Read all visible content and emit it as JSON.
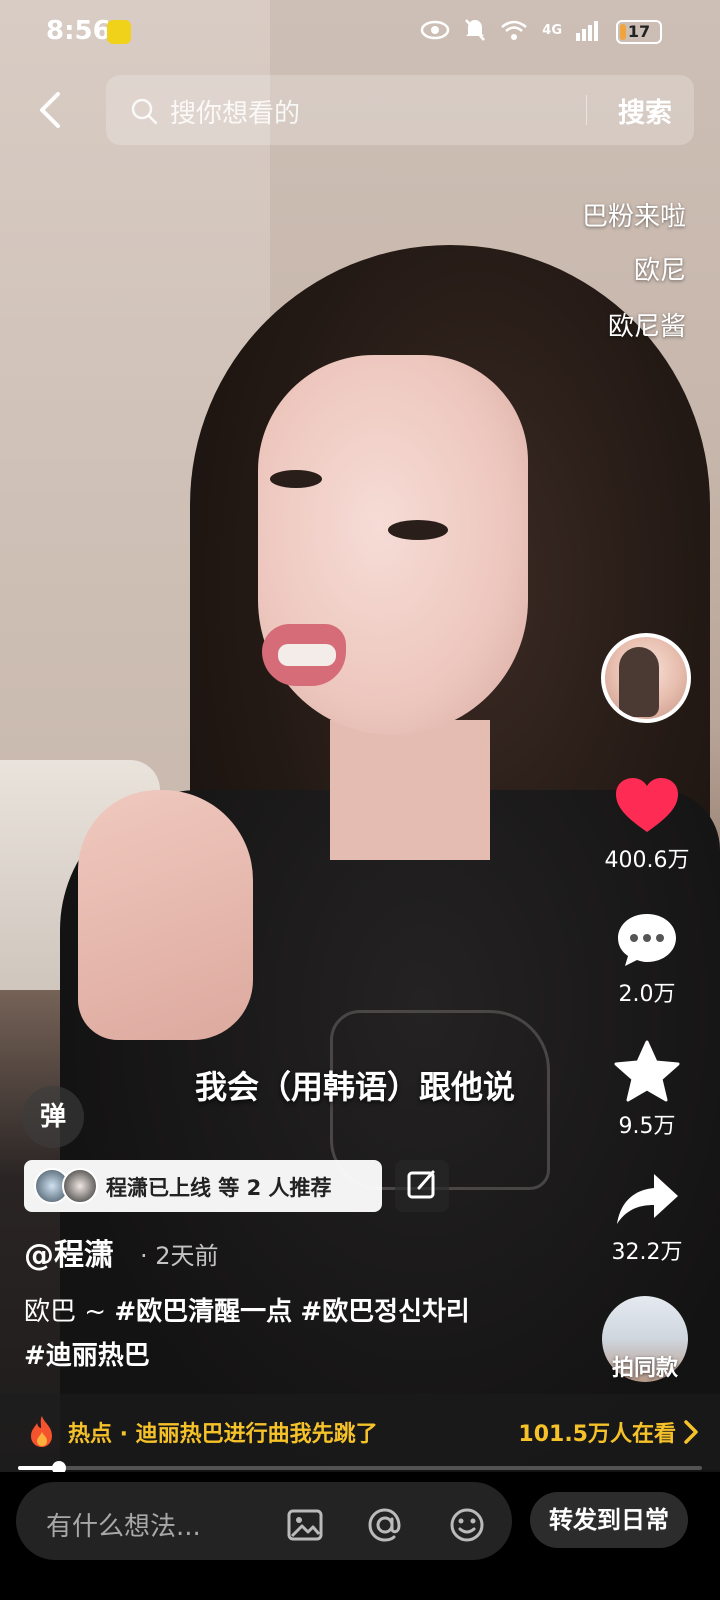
{
  "status_bar": {
    "time": "8:56",
    "network": "4G",
    "battery": "17",
    "battery_level": 0.17
  },
  "search": {
    "placeholder": "搜你想看的",
    "button_label": "搜索"
  },
  "danmaku": [
    "巴粉来啦",
    "欧尼",
    "欧尼酱"
  ],
  "actions": {
    "like_count": "400.6万",
    "comment_count": "2.0万",
    "favorite_count": "9.5万",
    "share_count": "32.2万",
    "same_style_label": "拍同款"
  },
  "subtitle": "我会（用韩语）跟他说",
  "danmaku_toggle_label": "弹",
  "recommendation": {
    "text": "程潇已上线 等 2 人推荐"
  },
  "post": {
    "author": "@程潇",
    "time": "· 2天前",
    "caption_prefix": "欧巴 ~ ",
    "tags": [
      "#欧巴清醒一点",
      "#欧巴정신차리",
      "#迪丽热巴"
    ]
  },
  "hot": {
    "text": "热点 · 迪丽热巴进行曲我先跳了",
    "viewers": "101.5万人在看"
  },
  "progress": 0.06,
  "comment_bar": {
    "placeholder": "有什么想法...",
    "share_daily_label": "转发到日常"
  },
  "colors": {
    "like": "#fe2c55",
    "hot_text": "#f6c229"
  }
}
